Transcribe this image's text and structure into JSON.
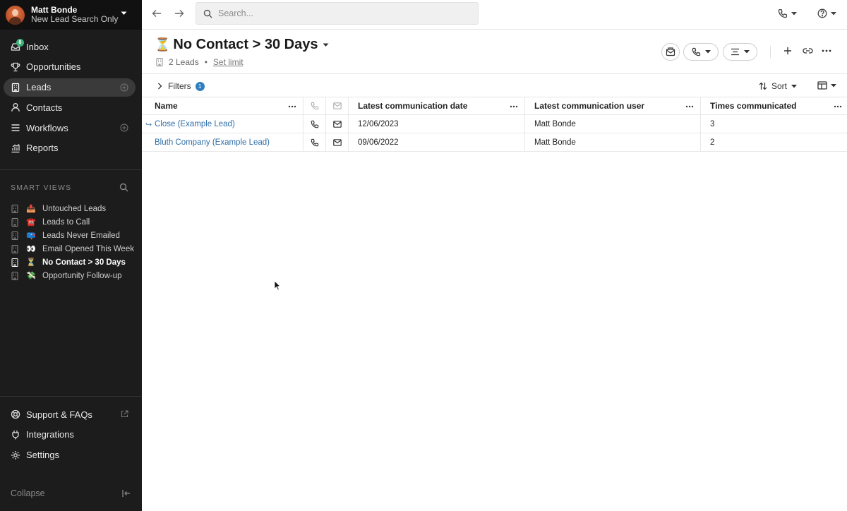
{
  "user": {
    "name": "Matt Bonde",
    "subtitle": "New Lead Search Only"
  },
  "nav": [
    {
      "label": "Inbox",
      "icon": "inbox-icon",
      "badge": "8"
    },
    {
      "label": "Opportunities",
      "icon": "trophy-icon"
    },
    {
      "label": "Leads",
      "icon": "building-icon",
      "active": true
    },
    {
      "label": "Contacts",
      "icon": "person-icon"
    },
    {
      "label": "Workflows",
      "icon": "list-icon"
    },
    {
      "label": "Reports",
      "icon": "chart-icon"
    }
  ],
  "smart_views": {
    "heading": "SMART VIEWS",
    "items": [
      {
        "emoji": "📤",
        "label": "Untouched Leads"
      },
      {
        "emoji": "☎️",
        "label": "Leads to Call"
      },
      {
        "emoji": "📪",
        "label": "Leads Never Emailed"
      },
      {
        "emoji": "👀",
        "label": "Email Opened This Week"
      },
      {
        "emoji": "⏳",
        "label": "No Contact > 30 Days",
        "active": true
      },
      {
        "emoji": "💸",
        "label": "Opportunity Follow-up"
      }
    ]
  },
  "bottom_nav": [
    {
      "label": "Support & FAQs",
      "icon": "lifebuoy-icon"
    },
    {
      "label": "Integrations",
      "icon": "plug-icon"
    },
    {
      "label": "Settings",
      "icon": "gear-icon"
    }
  ],
  "collapse_label": "Collapse",
  "search": {
    "placeholder": "Search..."
  },
  "view": {
    "emoji": "⏳",
    "title": "No Contact > 30 Days",
    "count_label": "2 Leads",
    "set_limit": "Set limit"
  },
  "filters": {
    "label": "Filters",
    "count": "1"
  },
  "sort_label": "Sort",
  "table": {
    "columns": {
      "name": "Name",
      "latest_date": "Latest communication date",
      "latest_user": "Latest communication user",
      "times": "Times communicated"
    },
    "rows": [
      {
        "name": "Close (Example Lead)",
        "date": "12/06/2023",
        "user": "Matt Bonde",
        "times": "3"
      },
      {
        "name": "Bluth Company (Example Lead)",
        "date": "09/06/2022",
        "user": "Matt Bonde",
        "times": "2"
      }
    ]
  },
  "colors": {
    "sidebar_bg": "#1c1c1c",
    "link_blue": "#2f6ea8",
    "badge_green": "#3fb47a",
    "badge_blue": "#2f7fc0"
  }
}
